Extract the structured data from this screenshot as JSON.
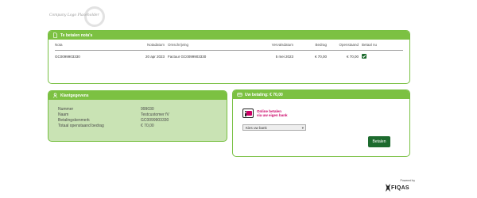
{
  "logo": {
    "text": "Company Logo Placeholder"
  },
  "invoices_panel": {
    "title": "Te betalen nota's",
    "columns": [
      "Nota",
      "Notadatum",
      "Omschrijving",
      "Vervalsdatum",
      "Bedrag",
      "Openstaand",
      "Betaal nu"
    ],
    "rows": [
      {
        "nota": "GC0099903330",
        "notadatum": "20 apr 2023",
        "omschrijving": "Factuur GC0099903330",
        "vervaldatum": "5 mei 2023",
        "bedrag": "€ 70,00",
        "openstaand": "€ 70,00",
        "betaal_nu": true
      }
    ]
  },
  "klant_panel": {
    "title": "Klantgegevens",
    "fields": [
      {
        "label": "Nummer",
        "value": "999030"
      },
      {
        "label": "Naam",
        "value": "Testcustomer fV"
      },
      {
        "label": "Betalingskenmerk",
        "value": "GC0099903330"
      },
      {
        "label": "Totaal openstaand bedrag",
        "value": "€ 70,00"
      }
    ]
  },
  "betaling_panel": {
    "title": "Uw betaling: € 70,00",
    "ideal_line1": "Online betalen",
    "ideal_line2": "via uw eigen bank",
    "bank_select_value": "Kies uw bank",
    "pay_button": "Betalen"
  },
  "footer": {
    "powered_by": "Powered by",
    "brand": "FIQAS"
  },
  "colors": {
    "accent": "#7cc142",
    "button": "#1d6b2e",
    "ideal_pink": "#cc0066",
    "klant_bg": "#c9e3b4"
  }
}
